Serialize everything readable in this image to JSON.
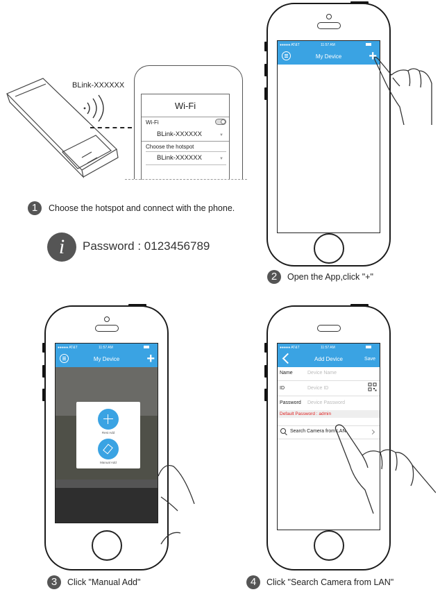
{
  "step1": {
    "number": "1",
    "text": "Choose the hotspot and connect with the phone.",
    "ssid_label": "BLink-XXXXXX",
    "wifi_panel": {
      "title": "Wi-Fi",
      "wifi_label": "Wi-Fi",
      "network": "BLink-XXXXXX",
      "choose_label": "Choose the hotspot",
      "hotspot": "BLink-XXXXXX"
    },
    "info_glyph": "i",
    "password_text": "Password : 0123456789"
  },
  "step2": {
    "number": "2",
    "text": "Open the App,click \"+\"",
    "status": {
      "carrier": "●●●●● AT&T",
      "time": "11:57 AM"
    },
    "nav_title": "My Device",
    "add_glyph": "+"
  },
  "step3": {
    "number": "3",
    "text": "Click \"Manual Add\"",
    "status": {
      "carrier": "●●●●● AT&T",
      "time": "11:57 AM"
    },
    "nav_title": "My Device",
    "add_glyph": "+",
    "popup": {
      "option1": "Rest Add",
      "option2": "Manual Add"
    }
  },
  "step4": {
    "number": "4",
    "text": "Click \"Search Camera from LAN\"",
    "status": {
      "carrier": "●●●●● AT&T",
      "time": "11:57 AM"
    },
    "nav_title": "Add Device",
    "save_label": "Save",
    "fields": [
      {
        "label": "Name",
        "placeholder": "Device Name"
      },
      {
        "label": "ID",
        "placeholder": "Device ID"
      },
      {
        "label": "Password",
        "placeholder": "Device Password"
      }
    ],
    "default_password": "Default Password : admin",
    "search_label": "Search Camera from LAN"
  },
  "colors": {
    "app_blue": "#3aa3e3",
    "step_badge": "#555555",
    "warning_red": "#e02020"
  }
}
